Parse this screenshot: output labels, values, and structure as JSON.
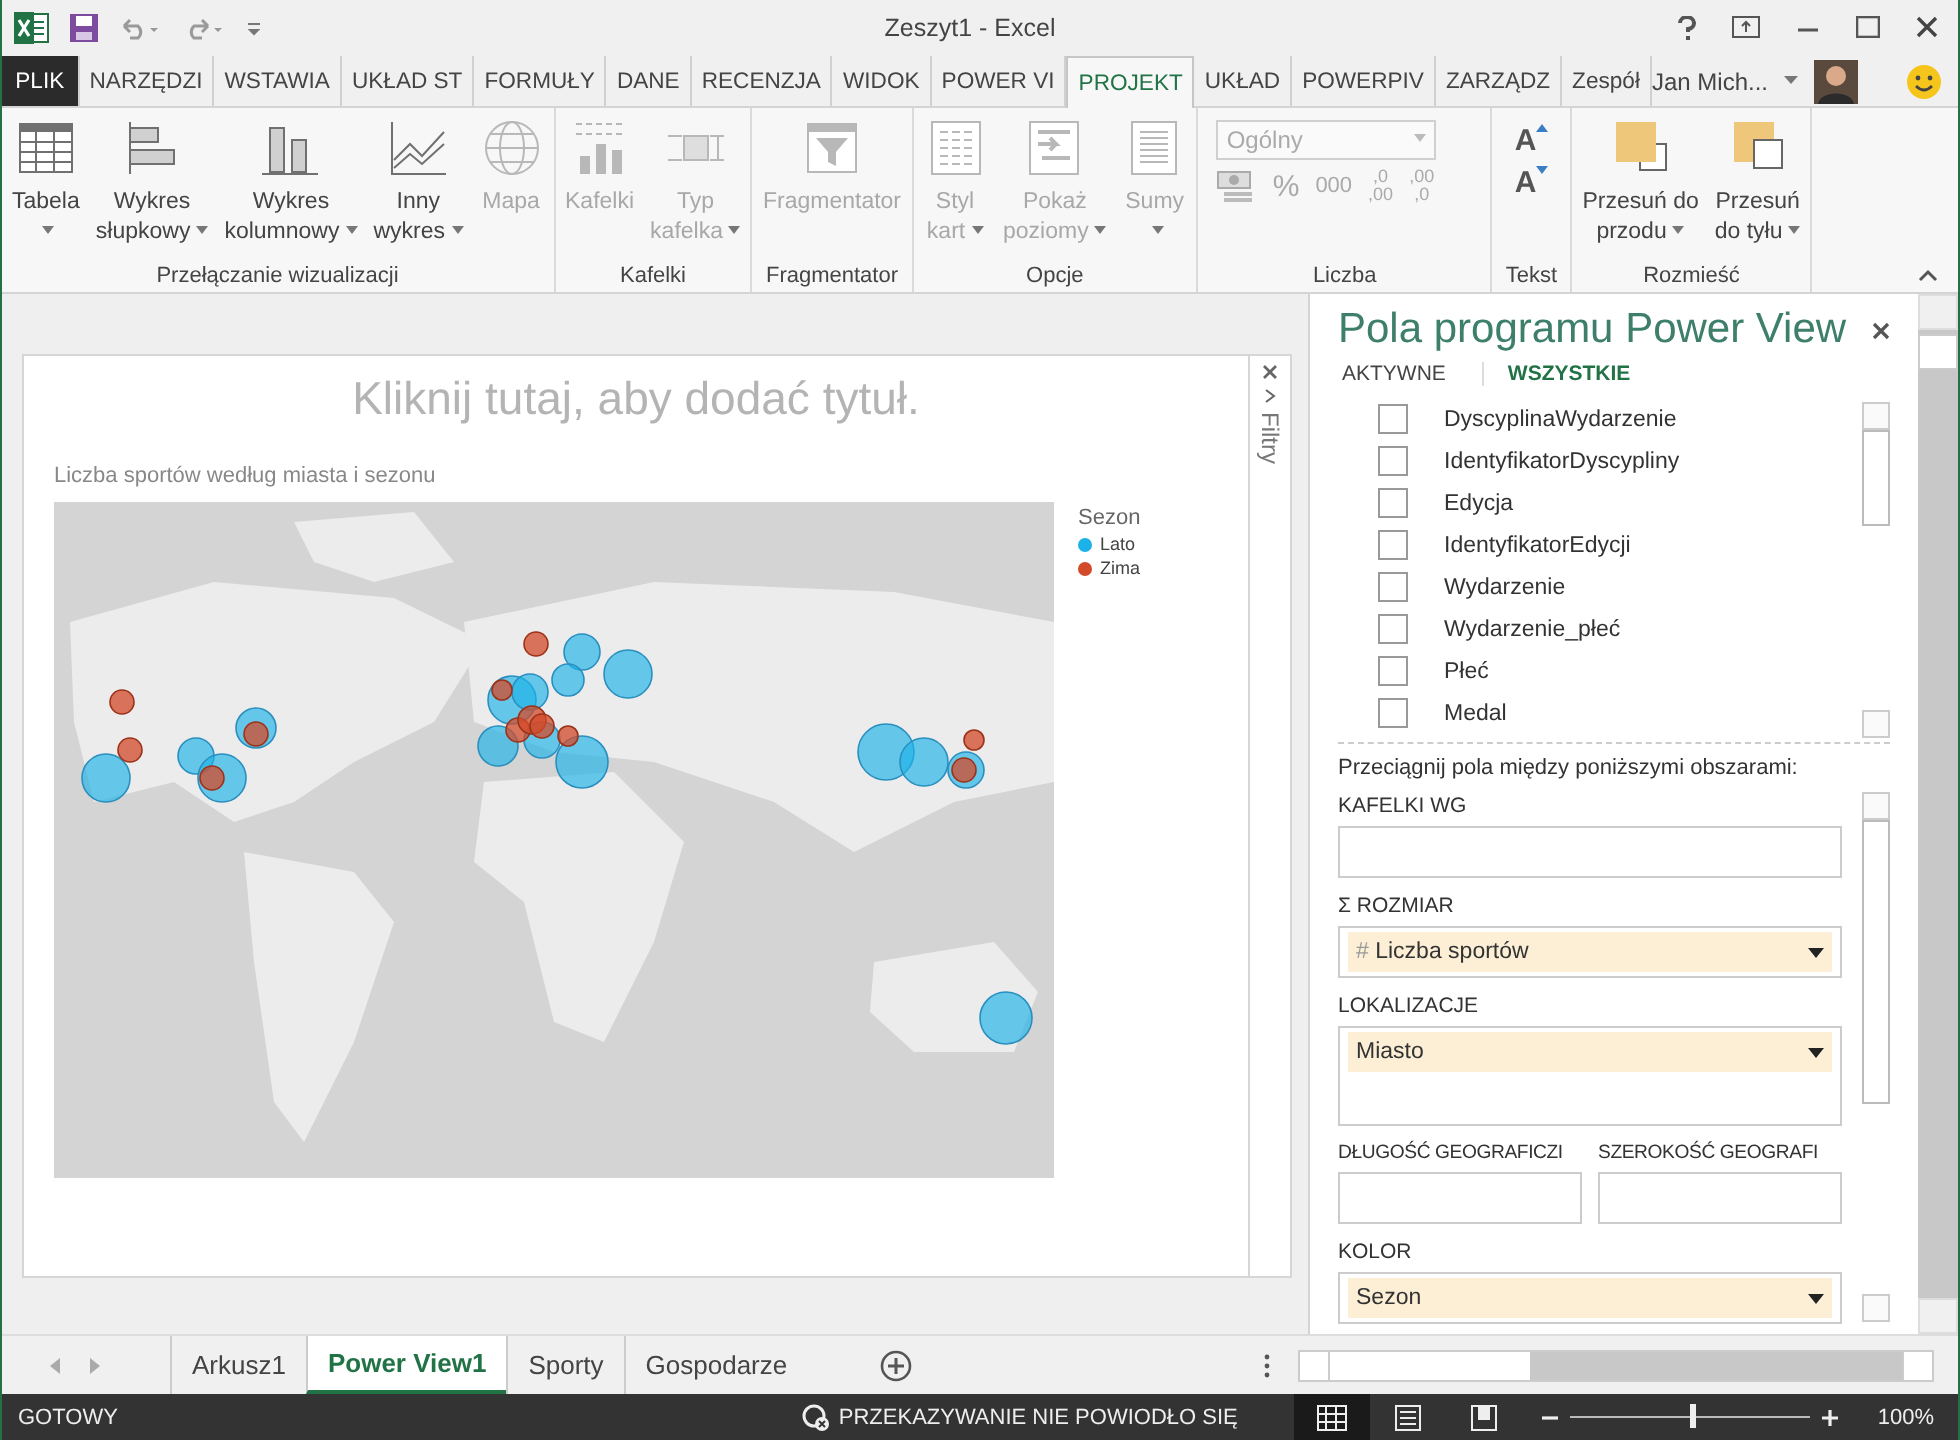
{
  "window": {
    "title": "Zeszyt1 - Excel"
  },
  "ribbon_tabs": [
    {
      "label": "PLIK",
      "kind": "file",
      "selected": false
    },
    {
      "label": "NARZĘDZI",
      "kind": "tab",
      "selected": false
    },
    {
      "label": "WSTAWIA",
      "kind": "tab",
      "selected": false
    },
    {
      "label": "UKŁAD ST",
      "kind": "tab",
      "selected": false
    },
    {
      "label": "FORMUŁY",
      "kind": "tab",
      "selected": false
    },
    {
      "label": "DANE",
      "kind": "tab",
      "selected": false
    },
    {
      "label": "RECENZJA",
      "kind": "tab",
      "selected": false
    },
    {
      "label": "WIDOK",
      "kind": "tab",
      "selected": false
    },
    {
      "label": "POWER VI",
      "kind": "tab",
      "selected": false
    },
    {
      "label": "PROJEKT",
      "kind": "tab",
      "selected": true
    },
    {
      "label": "UKŁAD",
      "kind": "tab",
      "selected": false
    },
    {
      "label": "POWERPIV",
      "kind": "tab",
      "selected": false
    },
    {
      "label": "ZARZĄDZ",
      "kind": "tab",
      "selected": false
    },
    {
      "label": "Zespół",
      "kind": "tab",
      "selected": false
    }
  ],
  "account": {
    "user": "Jan Mich..."
  },
  "ribbon_groups": [
    {
      "label": "Przełączanie wizualizacji",
      "kind": "buttons",
      "buttons": [
        {
          "lines": [
            "Tabela"
          ],
          "kind": "table",
          "disabled": false,
          "dropdown": true
        },
        {
          "lines": [
            "Wykres",
            "słupkowy"
          ],
          "kind": "bar",
          "disabled": false,
          "dropdown": true
        },
        {
          "lines": [
            "Wykres",
            "kolumnowy"
          ],
          "kind": "column",
          "disabled": false,
          "dropdown": true
        },
        {
          "lines": [
            "Inny",
            "wykres"
          ],
          "kind": "line",
          "disabled": false,
          "dropdown": true
        },
        {
          "lines": [
            "Mapa"
          ],
          "kind": "globe",
          "disabled": true,
          "dropdown": false
        }
      ]
    },
    {
      "label": "Kafelki",
      "kind": "buttons",
      "buttons": [
        {
          "lines": [
            "Kafelki"
          ],
          "kind": "tiles",
          "disabled": true,
          "dropdown": false
        },
        {
          "lines": [
            "Typ",
            "kafelka"
          ],
          "kind": "tiletype",
          "disabled": true,
          "dropdown": true
        }
      ]
    },
    {
      "label": "Fragmentator",
      "kind": "buttons",
      "buttons": [
        {
          "lines": [
            "Fragmentator"
          ],
          "kind": "slicer",
          "disabled": true,
          "dropdown": false
        }
      ]
    },
    {
      "label": "Opcje",
      "kind": "buttons",
      "buttons": [
        {
          "lines": [
            "Styl",
            "kart"
          ],
          "kind": "cards",
          "disabled": true,
          "dropdown": true
        },
        {
          "lines": [
            "Pokaż",
            "poziomy"
          ],
          "kind": "levels",
          "disabled": true,
          "dropdown": true
        },
        {
          "lines": [
            "Sumy"
          ],
          "kind": "totals",
          "disabled": true,
          "dropdown": true
        }
      ]
    },
    {
      "label": "Liczba",
      "kind": "number",
      "format": {
        "value": "Ogólny",
        "disabled": true
      },
      "tools": [
        {
          "kind": "currency"
        },
        {
          "kind": "text",
          "label": "%"
        },
        {
          "kind": "text",
          "label": "000"
        },
        {
          "kind": "decimals",
          "label": ",0",
          "sub": ",00"
        },
        {
          "kind": "decimals",
          "label": ",00",
          "sub": ",0"
        }
      ]
    },
    {
      "label": "Tekst",
      "kind": "text",
      "buttons": [
        {
          "label": "A",
          "kind": "grow"
        },
        {
          "label": "A",
          "kind": "shrink"
        }
      ]
    },
    {
      "label": "Rozmieść",
      "kind": "buttons",
      "buttons": [
        {
          "lines": [
            "Przesuń do",
            "przodu"
          ],
          "kind": "front",
          "disabled": false,
          "dropdown": true
        },
        {
          "lines": [
            "Przesuń",
            "do tyłu"
          ],
          "kind": "back",
          "disabled": false,
          "dropdown": true
        }
      ]
    }
  ],
  "canvas": {
    "title_placeholder": "Kliknij tutaj, aby dodać tytuł.",
    "filters_label": "Filtry",
    "map": {
      "title": "Liczba sportów według miasta i sezonu",
      "kind": "picture",
      "legend": {
        "title": "Sezon",
        "items": [
          {
            "label": "Lato",
            "color": "#1cb2e8"
          },
          {
            "label": "Zima",
            "color": "#d34a2a"
          }
        ]
      }
    }
  },
  "field_list": {
    "title": "Pola programu Power View",
    "tabs": [
      {
        "label": "AKTYWNE",
        "selected": false
      },
      {
        "label": "WSZYSTKIE",
        "selected": true
      }
    ],
    "fields": [
      {
        "name": "DyscyplinaWydarzenie",
        "checked": false
      },
      {
        "name": "IdentyfikatorDyscypliny",
        "checked": false
      },
      {
        "name": "Edycja",
        "checked": false
      },
      {
        "name": "IdentyfikatorEdycji",
        "checked": false
      },
      {
        "name": "Wydarzenie",
        "checked": false
      },
      {
        "name": "Wydarzenie_płeć",
        "checked": false
      },
      {
        "name": "Płeć",
        "checked": false
      },
      {
        "name": "Medal",
        "checked": false
      }
    ],
    "instruction": "Przeciągnij pola między poniższymi obszarami:",
    "areas": [
      {
        "label": "KAFELKI WG",
        "kind": "full"
      },
      {
        "label": "ROZMIAR",
        "prefix": "Σ",
        "kind": "full",
        "items": [
          {
            "name": "Liczba sportów",
            "prefix": "#"
          }
        ]
      },
      {
        "label": "LOKALIZACJE",
        "kind": "tall",
        "items": [
          {
            "name": "Miasto"
          }
        ]
      },
      {
        "label": "DŁUGOŚĆ GEOGRAFICZI",
        "kind": "half"
      },
      {
        "label": "SZEROKOŚĆ GEOGRAFI",
        "kind": "half"
      },
      {
        "label": "KOLOR",
        "kind": "full",
        "items": [
          {
            "name": "Sezon"
          }
        ]
      }
    ]
  },
  "sheet_tabs": [
    {
      "label": "Arkusz1",
      "selected": false
    },
    {
      "label": "Power View1",
      "selected": true
    },
    {
      "label": "Sporty",
      "selected": false
    },
    {
      "label": "Gospodarze",
      "selected": false
    }
  ],
  "status_bar": {
    "status": "GOTOWY",
    "notification": "PRZEKAZYWANIE NIE POWIODŁO SIĘ",
    "views": [
      {
        "kind": "normal",
        "selected": true
      },
      {
        "kind": "layout",
        "selected": false
      },
      {
        "kind": "pagebreak",
        "selected": false
      }
    ],
    "zoom": {
      "level": 0.5,
      "reading": "100%"
    }
  }
}
